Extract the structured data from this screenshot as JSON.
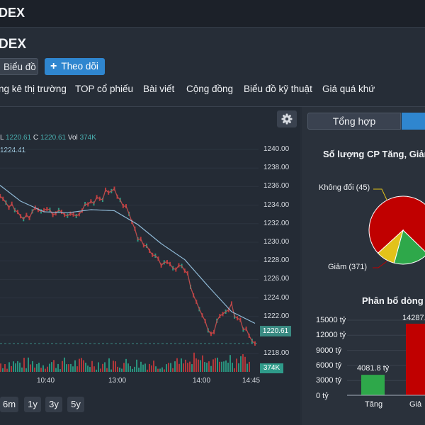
{
  "app": {
    "topbar_title": "DEX",
    "page_title": "DEX"
  },
  "actions": {
    "chart_label": "Biểu đồ",
    "follow_label": "Theo dõi",
    "follow_icon": "+"
  },
  "nav": [
    "ng kê thị trường",
    "TOP cổ phiếu",
    "Bài viết",
    "Cộng đồng",
    "Biểu đồ kỹ thuật",
    "Giá quá khứ"
  ],
  "tabs": {
    "summary": "Tổng hợp"
  },
  "legend": {
    "l_key": "L",
    "l_val": "1220.61",
    "c_key": "C",
    "c_val": "1220.61",
    "vol_key": "Vol",
    "vol_val": "374K",
    "ma_val": "1224.41"
  },
  "price_axis": [
    "1240.00",
    "1238.00",
    "1236.00",
    "1234.00",
    "1232.00",
    "1230.00",
    "1228.00",
    "1226.00",
    "1224.00",
    "1222.00",
    "1220.00",
    "1218.00"
  ],
  "time_axis": [
    "10:40",
    "13:00",
    "14:00",
    "14:45"
  ],
  "last_price_tag": "1220.61",
  "volume_tag": "374K",
  "ranges": [
    "6m",
    "1y",
    "3y",
    "5y"
  ],
  "breadth": {
    "title": "Số lượng CP Tăng, Giảm",
    "unchanged_label": "Không đổi (45)",
    "down_label": "Giảm (371)",
    "colors": {
      "down": "#c00000",
      "up": "#2ea84a",
      "unchanged": "#e2c21a"
    }
  },
  "flow": {
    "title": "Phân bổ dòng",
    "y_ticks": [
      "15000 tỷ",
      "12000 tỷ",
      "9000 tỷ",
      "6000 tỷ",
      "3000 tỷ",
      "0 tỷ"
    ],
    "up_value": "4081.8 tỷ",
    "down_value": "14287.",
    "cat_up": "Tăng",
    "cat_down": "Giả"
  },
  "chart_data": [
    {
      "type": "line",
      "title": "",
      "x": [
        "10:40",
        "13:00",
        "14:00",
        "14:45"
      ],
      "ylim": [
        1217,
        1241
      ],
      "series": [
        {
          "values": [
            1235.0,
            1232.4,
            1233.3,
            1232.6,
            1233.6,
            1235.4,
            1230.8,
            1228.2,
            1227.9,
            1221.5,
            1224.0,
            1220.6
          ]
        },
        {
          "values": [
            1235.7,
            1234.0,
            1233.0,
            1232.9,
            1233.2,
            1233.1,
            1231.8,
            1230.0,
            1228.5,
            1226.0,
            1223.6,
            1222.5
          ]
        }
      ]
    },
    {
      "type": "bar",
      "title": "Phân bổ dòng",
      "categories": [
        "Tăng",
        "Giả"
      ],
      "values": [
        4081.8,
        14287
      ],
      "ylim": [
        0,
        15000
      ]
    },
    {
      "type": "pie",
      "title": "Số lượng CP Tăng, Giảm",
      "categories": [
        "Giảm",
        "Tăng",
        "Không đổi"
      ],
      "values": [
        371,
        85,
        45
      ]
    }
  ]
}
